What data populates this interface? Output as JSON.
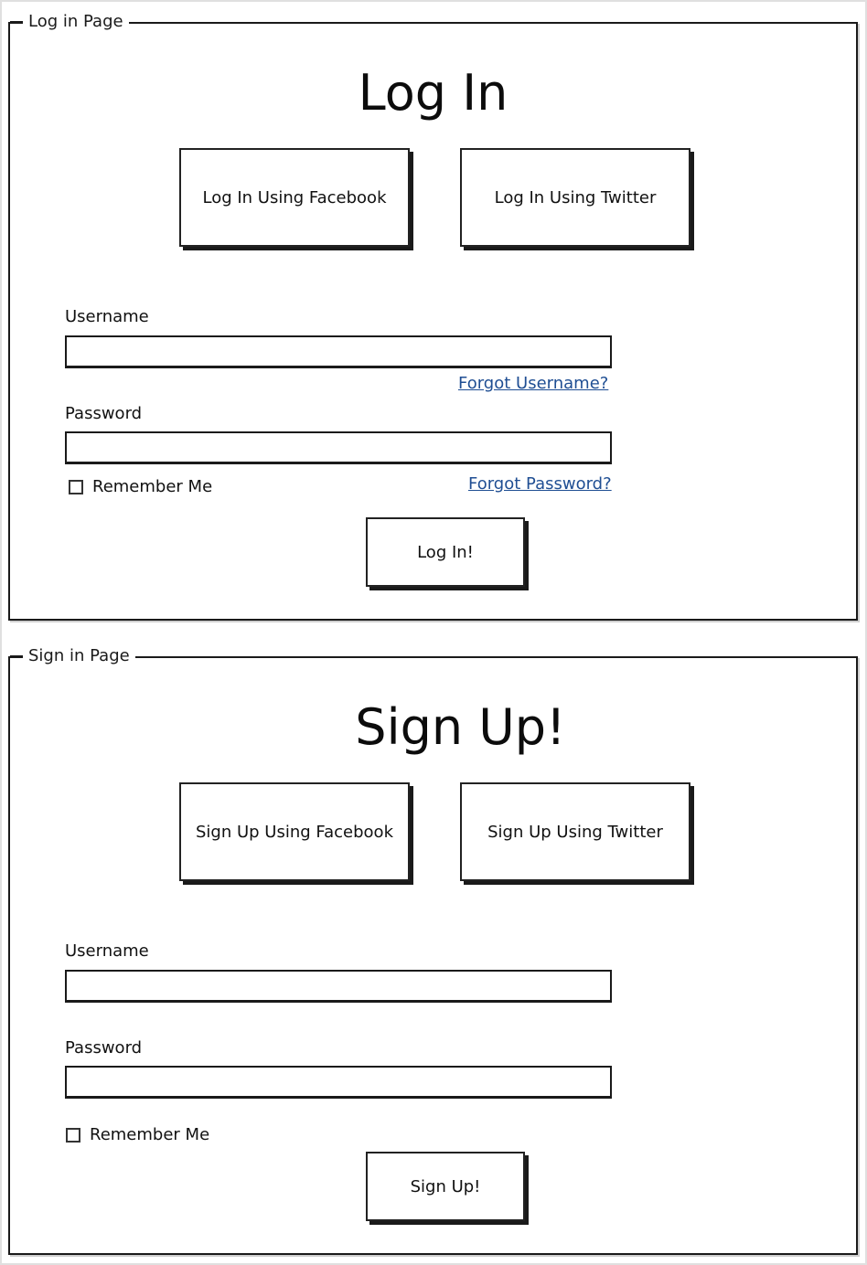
{
  "login": {
    "panel_label": "Log in Page",
    "title": "Log In",
    "facebook_button": "Log In Using Facebook",
    "twitter_button": "Log In Using Twitter",
    "username_label": "Username",
    "username_value": "",
    "forgot_username": "Forgot Username?",
    "password_label": "Password",
    "password_value": "",
    "remember_me": "Remember Me",
    "forgot_password": "Forgot Password?",
    "submit_button": "Log In!"
  },
  "signup": {
    "panel_label": "Sign in Page",
    "title": "Sign Up!",
    "facebook_button": "Sign Up Using Facebook",
    "twitter_button": "Sign Up Using Twitter",
    "username_label": "Username",
    "username_value": "",
    "password_label": "Password",
    "password_value": "",
    "remember_me": "Remember Me",
    "submit_button": "Sign Up!"
  },
  "colors": {
    "link": "#1f4e93",
    "border": "#1a1a1a"
  }
}
